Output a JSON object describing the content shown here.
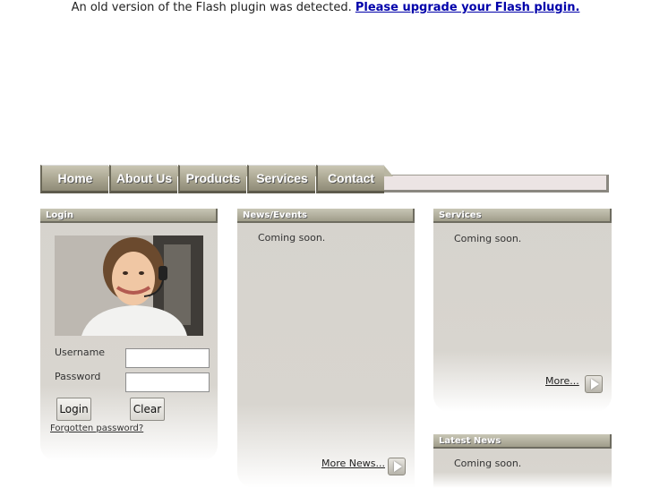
{
  "flash": {
    "message": "An old version of the Flash plugin was detected.",
    "link": "Please upgrade your Flash plugin."
  },
  "nav": {
    "tabs": [
      "Home",
      "About Us",
      "Products",
      "Services",
      "Contact"
    ]
  },
  "login": {
    "title": "Login",
    "username_label": "Username",
    "password_label": "Password",
    "login_button": "Login",
    "clear_button": "Clear",
    "forgot_link": "Forgotten password?"
  },
  "news": {
    "title": "News/Events",
    "text": "Coming soon.",
    "more": "More News..."
  },
  "services": {
    "title": "Services",
    "text": "Coming soon.",
    "more": "More..."
  },
  "latest": {
    "title": "Latest News",
    "text": "Coming soon."
  },
  "icons": {
    "arrow": "play-arrow-icon"
  }
}
